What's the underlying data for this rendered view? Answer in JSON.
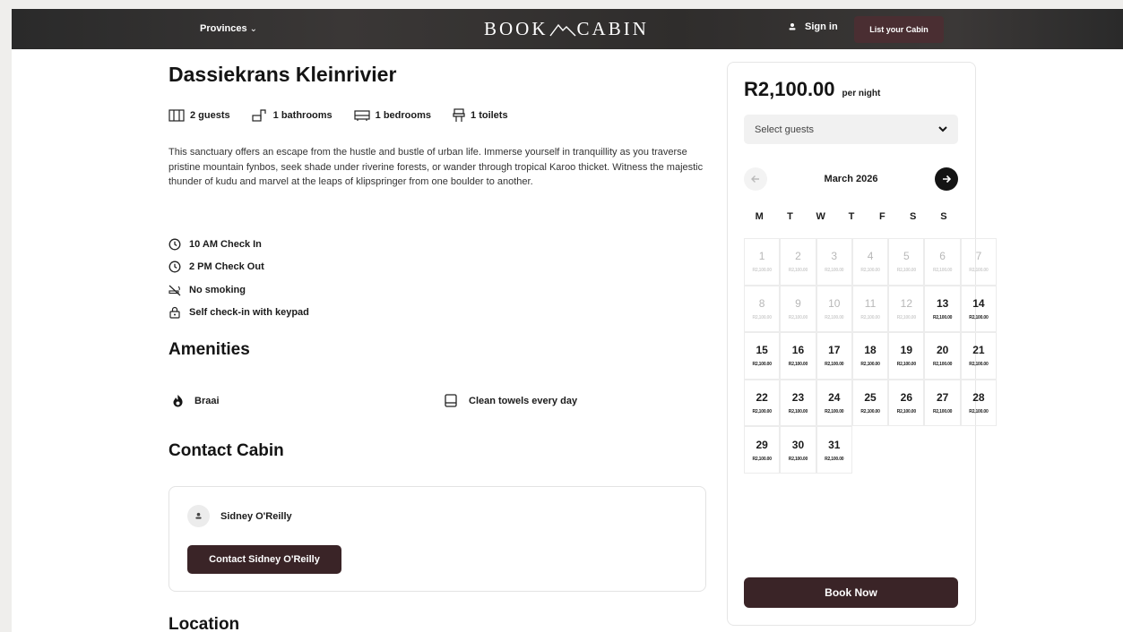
{
  "nav": {
    "provinces_label": "Provinces",
    "logo_left": "BOOK",
    "logo_right": "CABIN",
    "sign_in": "Sign in",
    "list_cabin": "List your Cabin"
  },
  "listing": {
    "title": "Dassiekrans Kleinrivier",
    "stats": [
      "2 guests",
      "1 bathrooms",
      "1 bedrooms",
      "1 toilets"
    ],
    "description": "This sanctuary offers an escape from the hustle and bustle of urban life. Immerse yourself in tranquillity as you traverse pristine mountain fynbos, seek shade under riverine forests, or wander through tropical Karoo thicket. Witness the majestic thunder of kudu and marvel at the leaps of klipspringer from one boulder to another.",
    "rules": [
      "10 AM Check In",
      "2 PM Check Out",
      "No smoking",
      "Self check-in with keypad"
    ]
  },
  "amenities": {
    "heading": "Amenities",
    "items": [
      "Braai",
      "Clean towels every day"
    ]
  },
  "contact": {
    "heading": "Contact Cabin",
    "host_name": "Sidney O'Reilly",
    "button": "Contact Sidney O'Reilly"
  },
  "location": {
    "heading": "Location"
  },
  "booking": {
    "price": "R2,100.00",
    "per": "per night",
    "guests_placeholder": "Select guests",
    "month": "March 2026",
    "weekdays": [
      "M",
      "T",
      "W",
      "T",
      "F",
      "S",
      "S"
    ],
    "day_price": "R2,100.00",
    "days": [
      1,
      2,
      3,
      4,
      5,
      6,
      7,
      8,
      9,
      10,
      11,
      12,
      13,
      14,
      15,
      16,
      17,
      18,
      19,
      20,
      21,
      22,
      23,
      24,
      25,
      26,
      27,
      28,
      29,
      30,
      31
    ],
    "first_available_day": 13,
    "book_now": "Book Now"
  },
  "colors": {
    "accent": "#3a2427",
    "list_btn": "#4a2e32",
    "topbar": "#2f2d2c"
  }
}
